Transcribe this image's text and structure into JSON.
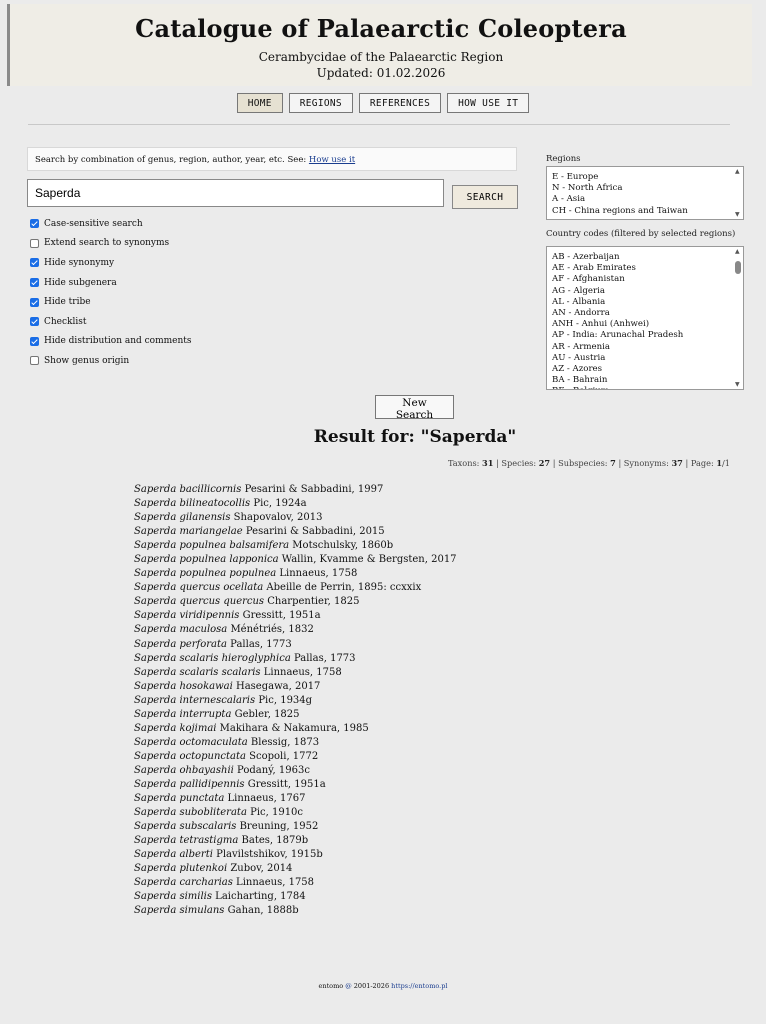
{
  "header": {
    "title": "Catalogue of Palaearctic Coleoptera",
    "subtitle": "Cerambycidae of the Palaearctic Region",
    "updated": "Updated: 01.02.2026"
  },
  "nav": [
    {
      "label": "HOME",
      "active": true
    },
    {
      "label": "REGIONS",
      "active": false
    },
    {
      "label": "REFERENCES",
      "active": false
    },
    {
      "label": "HOW USE IT",
      "active": false
    }
  ],
  "search": {
    "hint_text": "Search by combination of genus, region, author, year, etc. See: ",
    "hint_link": "How use it",
    "value": "Saperda",
    "button_label": "SEARCH"
  },
  "options": [
    {
      "label": "Case-sensitive search",
      "checked": true
    },
    {
      "label": "Extend search to synonyms",
      "checked": false
    },
    {
      "label": "Hide synonymy",
      "checked": true
    },
    {
      "label": "Hide subgenera",
      "checked": true
    },
    {
      "label": "Hide tribe",
      "checked": true
    },
    {
      "label": "Checklist",
      "checked": true
    },
    {
      "label": "Hide distribution and comments",
      "checked": true
    },
    {
      "label": "Show genus origin",
      "checked": false
    }
  ],
  "regions": {
    "label": "Regions",
    "items": [
      "E - Europe",
      "N - North Africa",
      "A - Asia",
      "CH - China regions and Taiwan"
    ]
  },
  "countries": {
    "label": "Country codes (filtered by selected regions)",
    "items": [
      "AB - Azerbaijan",
      "AE - Arab Emirates",
      "AF - Afghanistan",
      "AG - Algeria",
      "AL - Albania",
      "AN - Andorra",
      "ANH - Anhui (Anhwei)",
      "AP - India: Arunachal Pradesh",
      "AR - Armenia",
      "AU - Austria",
      "AZ - Azores",
      "BA - Bahrain",
      "BE - Belgium"
    ]
  },
  "new_search_label": "New Search",
  "result_title": "Result for: \"Saperda\"",
  "stats": {
    "taxons_label": "Taxons: ",
    "taxons": "31",
    "species_label": " | Species: ",
    "species": "27",
    "subspecies_label": " | Subspecies: ",
    "subspecies": "7",
    "synonyms_label": " | Synonyms: ",
    "synonyms": "37",
    "page_label": " | Page: ",
    "page": "1",
    "page_total": "/1"
  },
  "results": [
    {
      "name": "Saperda bacillicornis",
      "author": " Pesarini & Sabbadini, 1997"
    },
    {
      "name": "Saperda bilineatocollis",
      "author": " Pic, 1924a"
    },
    {
      "name": "Saperda gilanensis",
      "author": " Shapovalov, 2013"
    },
    {
      "name": "Saperda mariangelae",
      "author": " Pesarini & Sabbadini, 2015"
    },
    {
      "name": "Saperda populnea balsamifera",
      "author": " Motschulsky, 1860b"
    },
    {
      "name": "Saperda populnea lapponica",
      "author": " Wallin, Kvamme & Bergsten, 2017"
    },
    {
      "name": "Saperda populnea populnea",
      "author": " Linnaeus, 1758"
    },
    {
      "name": "Saperda quercus ocellata",
      "author": " Abeille de Perrin, 1895: ccxxix"
    },
    {
      "name": "Saperda quercus quercus",
      "author": " Charpentier, 1825"
    },
    {
      "name": "Saperda viridipennis",
      "author": " Gressitt, 1951a"
    },
    {
      "name": "Saperda maculosa",
      "author": " Ménétriés, 1832"
    },
    {
      "name": "Saperda perforata",
      "author": " Pallas, 1773"
    },
    {
      "name": "Saperda scalaris hieroglyphica",
      "author": " Pallas, 1773"
    },
    {
      "name": "Saperda scalaris scalaris",
      "author": " Linnaeus, 1758"
    },
    {
      "name": "Saperda hosokawai",
      "author": " Hasegawa, 2017"
    },
    {
      "name": "Saperda internescalaris",
      "author": " Pic, 1934g"
    },
    {
      "name": "Saperda interrupta",
      "author": " Gebler, 1825"
    },
    {
      "name": "Saperda kojimai",
      "author": " Makihara & Nakamura, 1985"
    },
    {
      "name": "Saperda octomaculata",
      "author": " Blessig, 1873"
    },
    {
      "name": "Saperda octopunctata",
      "author": " Scopoli, 1772"
    },
    {
      "name": "Saperda ohbayashii",
      "author": " Podaný, 1963c"
    },
    {
      "name": "Saperda pallidipennis",
      "author": " Gressitt, 1951a"
    },
    {
      "name": "Saperda punctata",
      "author": " Linnaeus, 1767"
    },
    {
      "name": "Saperda subobliterata",
      "author": " Pic, 1910c"
    },
    {
      "name": "Saperda subscalaris",
      "author": " Breuning, 1952"
    },
    {
      "name": "Saperda tetrastigma",
      "author": " Bates, 1879b"
    },
    {
      "name": "Saperda alberti",
      "author": " Plavilstshikov, 1915b"
    },
    {
      "name": "Saperda plutenkoi",
      "author": " Zubov, 2014"
    },
    {
      "name": "Saperda carcharias",
      "author": " Linnaeus, 1758"
    },
    {
      "name": "Saperda similis",
      "author": " Laicharting, 1784"
    },
    {
      "name": "Saperda simulans",
      "author": " Gahan, 1888b"
    }
  ],
  "footer": {
    "prefix": "entomo ",
    "copy_link": "@",
    "years": " 2001-2026 ",
    "url": "https://entomo.pl"
  }
}
